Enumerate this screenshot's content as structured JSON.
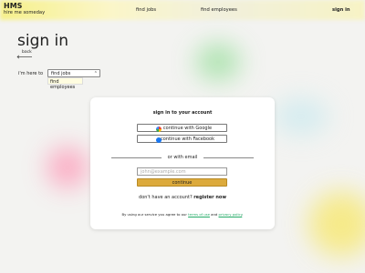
{
  "header": {
    "brand_title": "HMS",
    "brand_subtitle": "hire me someday",
    "nav": {
      "find_jobs": "find jobs",
      "find_employees": "find employees",
      "sign_in": "sign in"
    }
  },
  "page": {
    "title": "sign in",
    "back_label": "back",
    "here_to_label": "i'm here to",
    "select": {
      "selected": "find jobs",
      "visible_option": "find employees"
    }
  },
  "card": {
    "title": "sign in to your account",
    "google_label": "continue with Google",
    "facebook_label": "continue with Facebook",
    "divider_text": "or with email",
    "email_placeholder": "john@example.com",
    "continue_label": "continue",
    "no_account_text": "don't have an account?",
    "register_label": "register now",
    "terms_prefix": "By using our service you agree to our",
    "terms_link": "terms of use",
    "terms_and": "and",
    "privacy_link": "privacy policy",
    "terms_suffix": "."
  },
  "colors": {
    "continue_button": "#dcaa3c",
    "card_background": "#ffffff",
    "facebook_blue": "#1877f2",
    "accent_top": "#f6f08a"
  },
  "icons": {
    "google": "google-icon",
    "facebook": "facebook-icon",
    "back": "arrow-left-icon",
    "select": "chevron-down-icon"
  }
}
